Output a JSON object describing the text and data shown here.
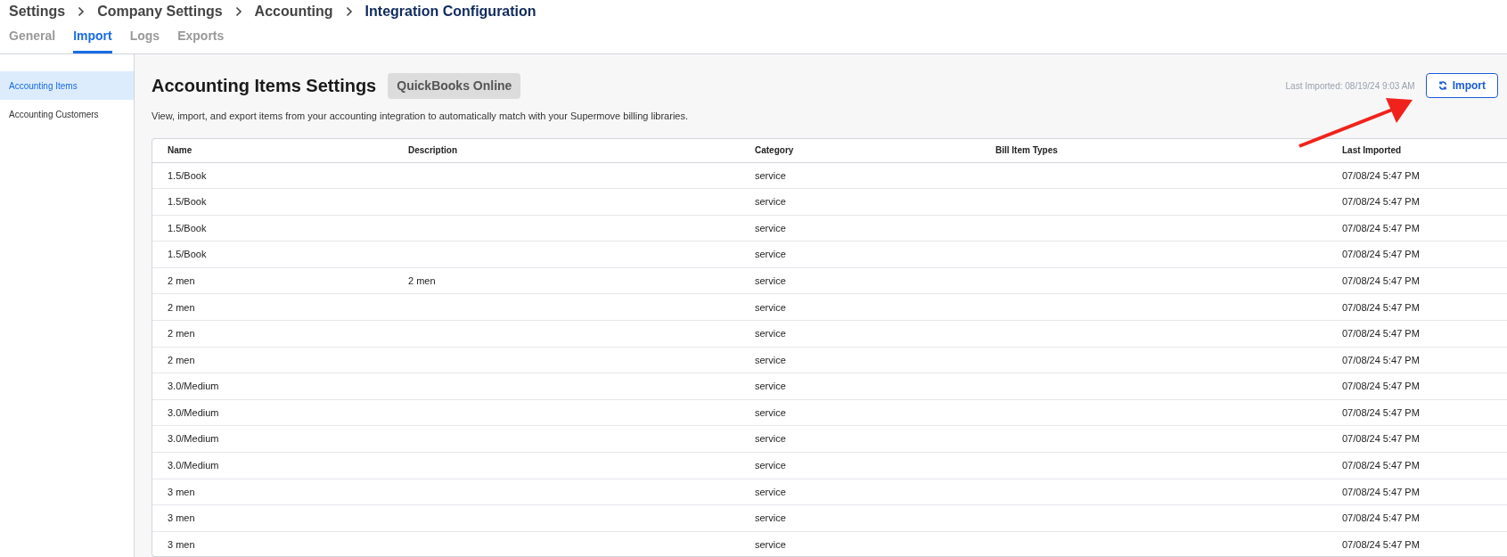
{
  "breadcrumb": [
    {
      "label": "Settings",
      "current": false
    },
    {
      "label": "Company Settings",
      "current": false
    },
    {
      "label": "Accounting",
      "current": false
    },
    {
      "label": "Integration Configuration",
      "current": true
    }
  ],
  "tabs": [
    {
      "label": "General",
      "selected": false
    },
    {
      "label": "Import",
      "selected": true
    },
    {
      "label": "Logs",
      "selected": false
    },
    {
      "label": "Exports",
      "selected": false
    }
  ],
  "sidebar": {
    "items": [
      {
        "label": "Accounting Items",
        "selected": true
      },
      {
        "label": "Accounting Customers",
        "selected": false
      }
    ]
  },
  "header": {
    "title": "Accounting Items Settings",
    "badge": "QuickBooks Online",
    "last_imported": "Last Imported: 08/19/24 9:03 AM",
    "import_button": "Import",
    "description": "View, import, and export items from your accounting integration to automatically match with your Supermove billing libraries."
  },
  "table": {
    "columns": [
      "Name",
      "Description",
      "Category",
      "Bill Item Types",
      "Last Imported"
    ],
    "rows": [
      [
        "1.5/Book",
        "",
        "service",
        "",
        "07/08/24 5:47 PM"
      ],
      [
        "1.5/Book",
        "",
        "service",
        "",
        "07/08/24 5:47 PM"
      ],
      [
        "1.5/Book",
        "",
        "service",
        "",
        "07/08/24 5:47 PM"
      ],
      [
        "1.5/Book",
        "",
        "service",
        "",
        "07/08/24 5:47 PM"
      ],
      [
        "2 men",
        "2 men",
        "service",
        "",
        "07/08/24 5:47 PM"
      ],
      [
        "2 men",
        "",
        "service",
        "",
        "07/08/24 5:47 PM"
      ],
      [
        "2 men",
        "",
        "service",
        "",
        "07/08/24 5:47 PM"
      ],
      [
        "2 men",
        "",
        "service",
        "",
        "07/08/24 5:47 PM"
      ],
      [
        "3.0/Medium",
        "",
        "service",
        "",
        "07/08/24 5:47 PM"
      ],
      [
        "3.0/Medium",
        "",
        "service",
        "",
        "07/08/24 5:47 PM"
      ],
      [
        "3.0/Medium",
        "",
        "service",
        "",
        "07/08/24 5:47 PM"
      ],
      [
        "3.0/Medium",
        "",
        "service",
        "",
        "07/08/24 5:47 PM"
      ],
      [
        "3 men",
        "",
        "service",
        "",
        "07/08/24 5:47 PM"
      ],
      [
        "3 men",
        "",
        "service",
        "",
        "07/08/24 5:47 PM"
      ],
      [
        "3 men",
        "",
        "service",
        "",
        "07/08/24 5:47 PM"
      ]
    ]
  }
}
